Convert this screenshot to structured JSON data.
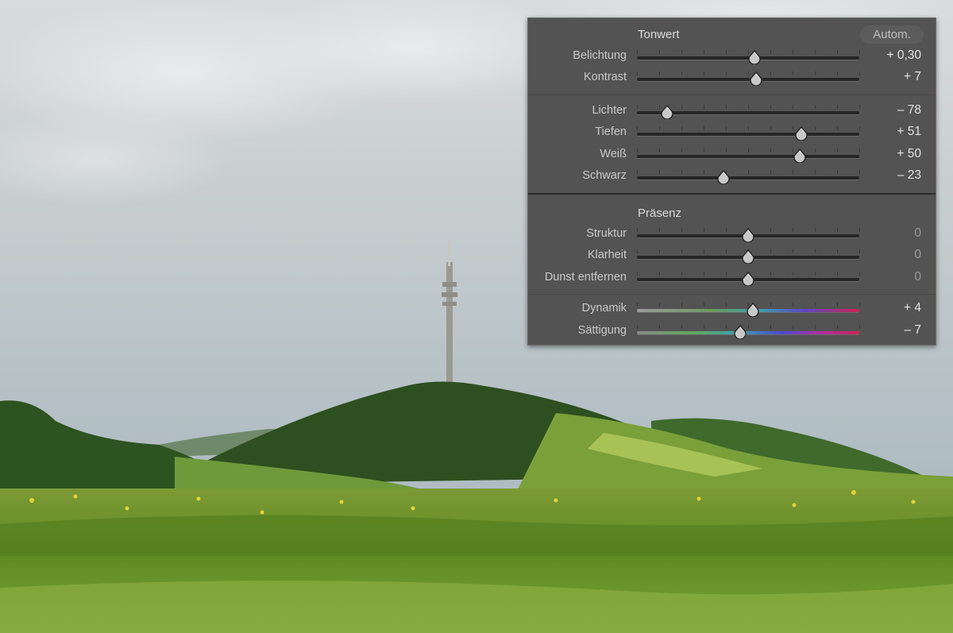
{
  "panel": {
    "tone": {
      "title": "Tonwert",
      "auto_label": "Autom.",
      "sliders": [
        {
          "label": "Belichtung",
          "value_text": "+ 0,30",
          "level": 0.53
        },
        {
          "label": "Kontrast",
          "value_text": "+ 7",
          "level": 0.535
        }
      ],
      "sliders2": [
        {
          "label": "Lichter",
          "value_text": "– 78",
          "level": 0.135
        },
        {
          "label": "Tiefen",
          "value_text": "+ 51",
          "level": 0.738
        },
        {
          "label": "Weiß",
          "value_text": "+ 50",
          "level": 0.733
        },
        {
          "label": "Schwarz",
          "value_text": "– 23",
          "level": 0.39
        }
      ]
    },
    "presence": {
      "title": "Präsenz",
      "sliders": [
        {
          "label": "Struktur",
          "value_text": "0",
          "level": 0.5
        },
        {
          "label": "Klarheit",
          "value_text": "0",
          "level": 0.5
        },
        {
          "label": "Dunst entfernen",
          "value_text": "0",
          "level": 0.5
        }
      ],
      "sliders2": [
        {
          "label": "Dynamik",
          "value_text": "+ 4",
          "level": 0.52
        },
        {
          "label": "Sättigung",
          "value_text": "– 7",
          "level": 0.465
        }
      ]
    }
  }
}
